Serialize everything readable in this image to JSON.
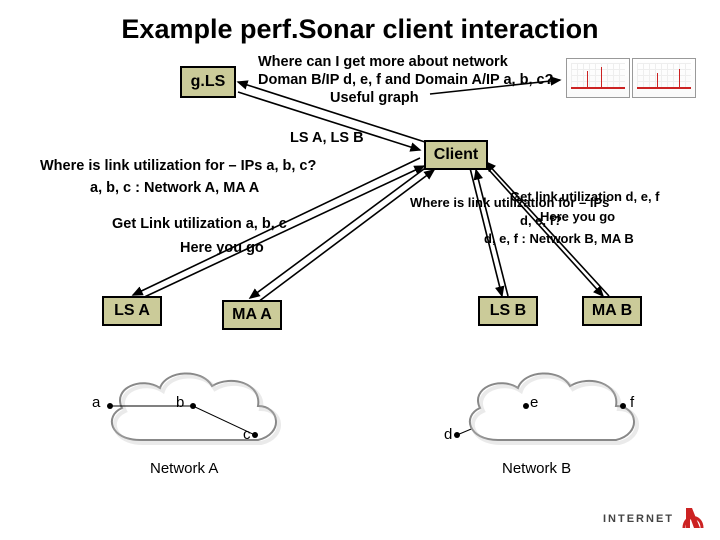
{
  "title": "Example perf.Sonar client interaction",
  "q1_line1": "Where can I get more about network",
  "q1_line2": "Doman B/IP d, e, f and Domain A/IP a, b, c?",
  "q1_line3": "Useful graph",
  "boxes": {
    "gls": "g.LS",
    "client": "Client",
    "lsa": "LS A",
    "maa": "MA A",
    "lsb": "LS B",
    "mab": "MA B"
  },
  "lsab": "LS A, LS B",
  "left_block": {
    "l1": "Where is link utilization for – IPs a, b, c?",
    "l2": "a, b, c : Network A, MA A",
    "l3": "Get Link utilization a, b, c",
    "l4": "Here you go"
  },
  "right_block": {
    "r1": "Where is link utilization for – IPs",
    "r1b": "Get link utilization d, e, f",
    "r2": "d, e, f?",
    "r2b": "Here you go",
    "r3": "d, e, f : Network B, MA B"
  },
  "clouds": {
    "a": "Network A",
    "b": "Network B"
  },
  "nodes": {
    "a": "a",
    "b": "b",
    "c": "c",
    "d": "d",
    "e": "e",
    "f": "f"
  },
  "logo": {
    "text": "INTERNET"
  }
}
